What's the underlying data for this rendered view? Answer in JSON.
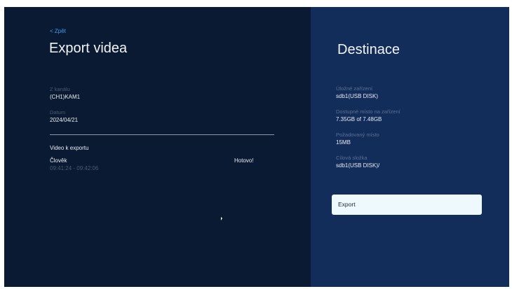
{
  "left_panel": {
    "back_label": "< Zpět",
    "title": "Export videa",
    "channel": {
      "label": "Z kanálu",
      "value": "(CH1)KAM1"
    },
    "date": {
      "label": "Datum",
      "value": "2024/04/21"
    },
    "section_title": "Video k exportu",
    "video_item": {
      "name": "Člověk",
      "time_range": "09:41:24 - 09:42:06",
      "status": "Hotovo!"
    }
  },
  "right_panel": {
    "title": "Destinace",
    "storage_device": {
      "label": "Úložné zařízení",
      "value": "sdb1(USB DISK)"
    },
    "available_space": {
      "label": "Dostupné místo na zařízení",
      "value": "7.35GB of 7.48GB"
    },
    "required_space": {
      "label": "Požadovaný místo",
      "value": "15MB"
    },
    "target_folder": {
      "label": "Cílová složka",
      "value": "sdb1(USB DISK)/"
    },
    "export_button_label": "Export"
  },
  "colors": {
    "left_background": "#0b1a33",
    "right_background": "#132d5b",
    "accent": "#3aa0e8",
    "button_background": "#eef9fd"
  }
}
